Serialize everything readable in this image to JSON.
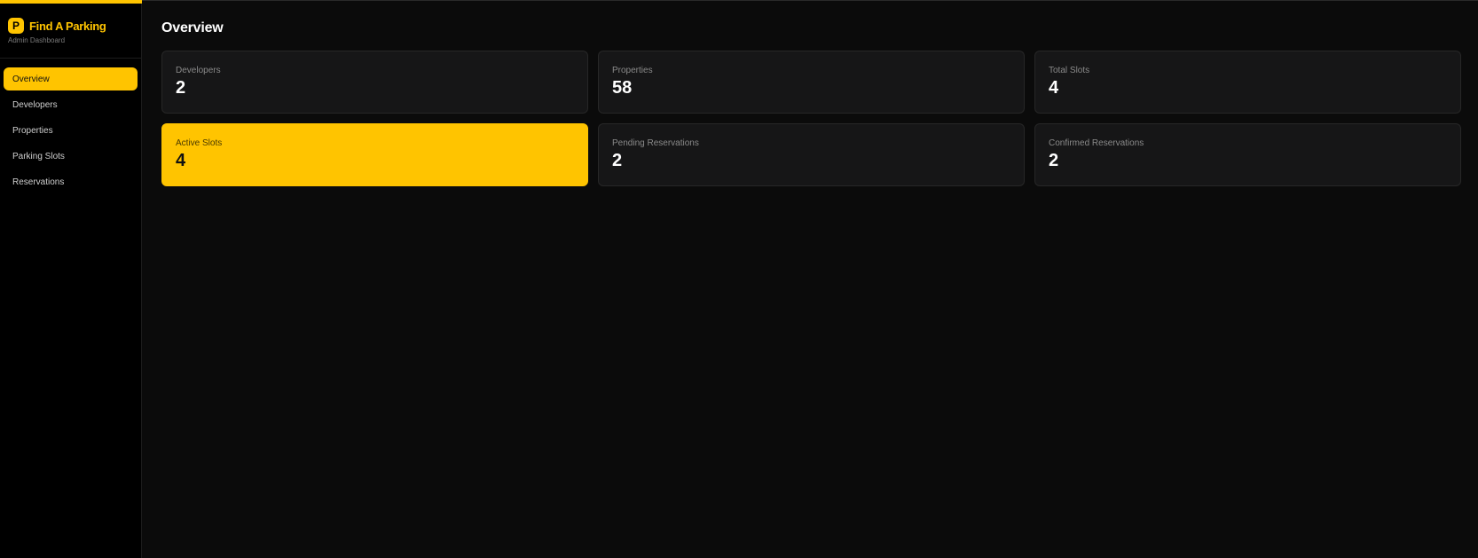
{
  "brand": {
    "logo_letter": "P",
    "name": "Find A Parking",
    "subtitle": "Admin Dashboard",
    "accent_color": "#ffc400"
  },
  "sidebar": {
    "items": [
      {
        "label": "Overview",
        "active": true
      },
      {
        "label": "Developers",
        "active": false
      },
      {
        "label": "Properties",
        "active": false
      },
      {
        "label": "Parking Slots",
        "active": false
      },
      {
        "label": "Reservations",
        "active": false
      }
    ]
  },
  "main": {
    "title": "Overview",
    "stats": [
      {
        "label": "Developers",
        "value": "2",
        "highlight": false
      },
      {
        "label": "Properties",
        "value": "58",
        "highlight": false
      },
      {
        "label": "Total Slots",
        "value": "4",
        "highlight": false
      },
      {
        "label": "Active Slots",
        "value": "4",
        "highlight": true
      },
      {
        "label": "Pending Reservations",
        "value": "2",
        "highlight": false
      },
      {
        "label": "Confirmed Reservations",
        "value": "2",
        "highlight": false
      }
    ]
  }
}
